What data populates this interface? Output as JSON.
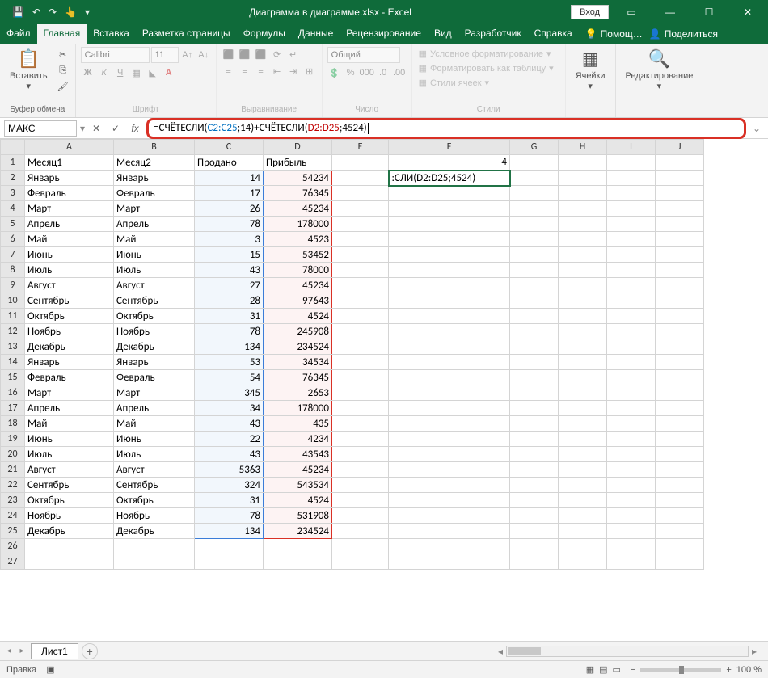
{
  "title": "Диаграмма в диаграмме.xlsx - Excel",
  "login": "Вход",
  "tabs": {
    "file": "Файл",
    "home": "Главная",
    "insert": "Вставка",
    "pagelayout": "Разметка страницы",
    "formulas": "Формулы",
    "data": "Данные",
    "review": "Рецензирование",
    "view": "Вид",
    "developer": "Разработчик",
    "help": "Справка",
    "tell_me": "Помощ…",
    "share": "Поделиться"
  },
  "ribbon": {
    "clipboard": {
      "paste": "Вставить",
      "label": "Буфер обмена"
    },
    "font": {
      "name": "Calibri",
      "size": "11",
      "label": "Шрифт"
    },
    "alignment": {
      "label": "Выравнивание"
    },
    "number": {
      "format": "Общий",
      "label": "Число"
    },
    "styles": {
      "conditional": "Условное форматирование",
      "table": "Форматировать как таблицу",
      "cell": "Стили ячеек",
      "label": "Стили"
    },
    "cells": {
      "label": "Ячейки"
    },
    "editing": {
      "label": "Редактирование"
    }
  },
  "namebox": "МАКС",
  "formula": {
    "prefix": "=СЧЁТЕСЛИ(",
    "ref1": "C2:C25",
    "mid1": ";14)+СЧЁТЕСЛИ(",
    "ref2": "D2:D25",
    "suffix": ";4524)"
  },
  "cols": [
    "A",
    "B",
    "C",
    "D",
    "E",
    "F",
    "G",
    "H",
    "I",
    "J"
  ],
  "headers": {
    "a": "Месяц1",
    "b": "Месяц2",
    "c": "Продано",
    "d": "Прибыль"
  },
  "f1": "4",
  "f2": ":СЛИ(D2:D25;4524)",
  "rows": [
    {
      "a": "Январь",
      "b": "Январь",
      "c": "14",
      "d": "54234"
    },
    {
      "a": "Февраль",
      "b": "Февраль",
      "c": "17",
      "d": "76345"
    },
    {
      "a": "Март",
      "b": "Март",
      "c": "26",
      "d": "45234"
    },
    {
      "a": "Апрель",
      "b": "Апрель",
      "c": "78",
      "d": "178000"
    },
    {
      "a": "Май",
      "b": "Май",
      "c": "3",
      "d": "4523"
    },
    {
      "a": "Июнь",
      "b": "Июнь",
      "c": "15",
      "d": "53452"
    },
    {
      "a": "Июль",
      "b": "Июль",
      "c": "43",
      "d": "78000"
    },
    {
      "a": "Август",
      "b": "Август",
      "c": "27",
      "d": "45234"
    },
    {
      "a": "Сентябрь",
      "b": "Сентябрь",
      "c": "28",
      "d": "97643"
    },
    {
      "a": "Октябрь",
      "b": "Октябрь",
      "c": "31",
      "d": "4524"
    },
    {
      "a": "Ноябрь",
      "b": "Ноябрь",
      "c": "78",
      "d": "245908"
    },
    {
      "a": "Декабрь",
      "b": "Декабрь",
      "c": "134",
      "d": "234524"
    },
    {
      "a": "Январь",
      "b": "Январь",
      "c": "53",
      "d": "34534"
    },
    {
      "a": "Февраль",
      "b": "Февраль",
      "c": "54",
      "d": "76345"
    },
    {
      "a": "Март",
      "b": "Март",
      "c": "345",
      "d": "2653"
    },
    {
      "a": "Апрель",
      "b": "Апрель",
      "c": "34",
      "d": "178000"
    },
    {
      "a": "Май",
      "b": "Май",
      "c": "43",
      "d": "435"
    },
    {
      "a": "Июнь",
      "b": "Июнь",
      "c": "22",
      "d": "4234"
    },
    {
      "a": "Июль",
      "b": "Июль",
      "c": "43",
      "d": "43543"
    },
    {
      "a": "Август",
      "b": "Август",
      "c": "5363",
      "d": "45234"
    },
    {
      "a": "Сентябрь",
      "b": "Сентябрь",
      "c": "324",
      "d": "543534"
    },
    {
      "a": "Октябрь",
      "b": "Октябрь",
      "c": "31",
      "d": "4524"
    },
    {
      "a": "Ноябрь",
      "b": "Ноябрь",
      "c": "78",
      "d": "531908"
    },
    {
      "a": "Декабрь",
      "b": "Декабрь",
      "c": "134",
      "d": "234524"
    }
  ],
  "sheet": "Лист1",
  "status": "Правка",
  "zoom": "100 %"
}
